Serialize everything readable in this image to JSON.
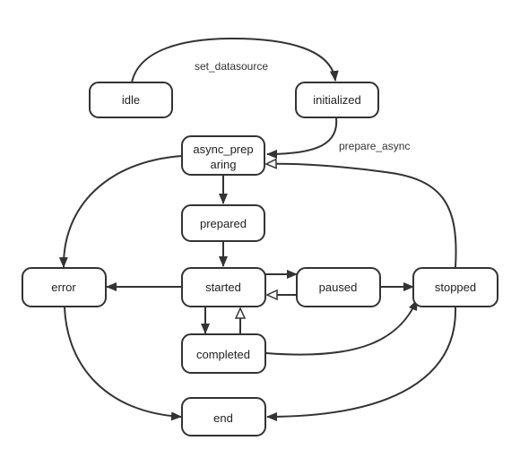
{
  "states": {
    "idle": "idle",
    "initialized": "initialized",
    "async_preparing_line1": "async_prep",
    "async_preparing_line2": "aring",
    "prepared": "prepared",
    "error": "error",
    "started": "started",
    "paused": "paused",
    "stopped": "stopped",
    "completed": "completed",
    "end": "end"
  },
  "transitions": {
    "set_datasource": "set_datasource",
    "prepare_async": "prepare_async"
  },
  "colors": {
    "stroke": "#333333",
    "text": "#222222",
    "background": "#ffffff"
  }
}
